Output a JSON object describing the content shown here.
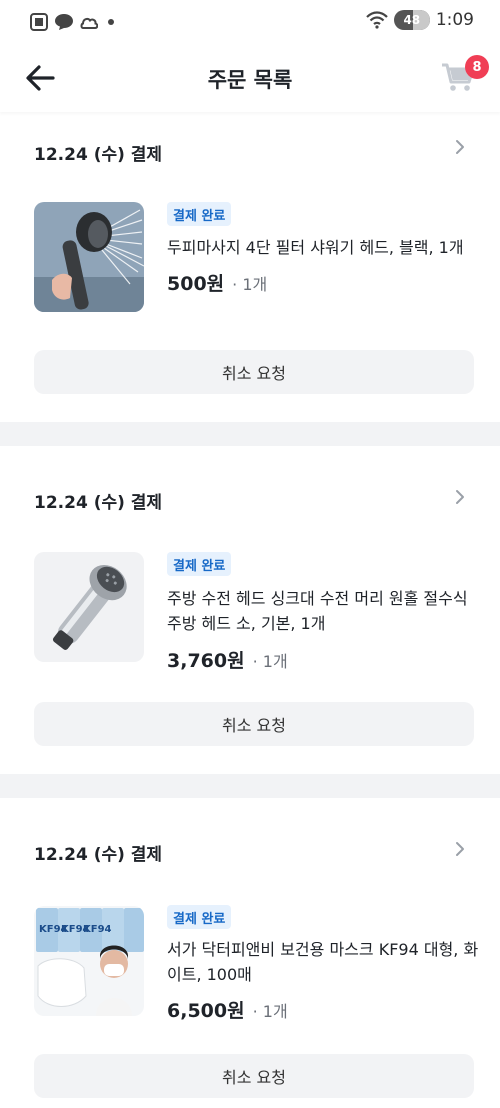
{
  "status_bar": {
    "time": "1:09",
    "battery": "48",
    "battery_level": 0.48,
    "left_icons": [
      "screenshot-icon",
      "chat-bubble-icon",
      "cloud-icon",
      "notification-dot-icon"
    ],
    "right_icons": [
      "wifi-icon",
      "battery-icon"
    ]
  },
  "header": {
    "title": "주문 목록",
    "cart_count": "8"
  },
  "orders": [
    {
      "date": "12.24 (수) 결제",
      "status": "결제 완료",
      "name": "두피마사지 4단 필터 샤워기 헤드, 블랙, 1개",
      "price": "500원",
      "qty": "· 1개",
      "cancel": "취소 요청"
    },
    {
      "date": "12.24 (수) 결제",
      "status": "결제 완료",
      "name": "주방 수전 헤드 싱크대 수전 머리 원홀 절수식 주방 헤드 소, 기본, 1개",
      "price": "3,760원",
      "qty": "· 1개",
      "cancel": "취소 요청"
    },
    {
      "date": "12.24 (수) 결제",
      "status": "결제 완료",
      "name": "서가 닥터피앤비 보건용 마스크 KF94 대형, 화이트, 100매",
      "price": "6,500원",
      "qty": "· 1개",
      "cancel": "취소 요청",
      "thumb_text": "KF94"
    }
  ],
  "colors": {
    "accent_badge_bg": "#e6f1fd",
    "accent_badge_text": "#1769c7",
    "cart_badge": "#f03e55",
    "separator": "#f2f3f5"
  }
}
